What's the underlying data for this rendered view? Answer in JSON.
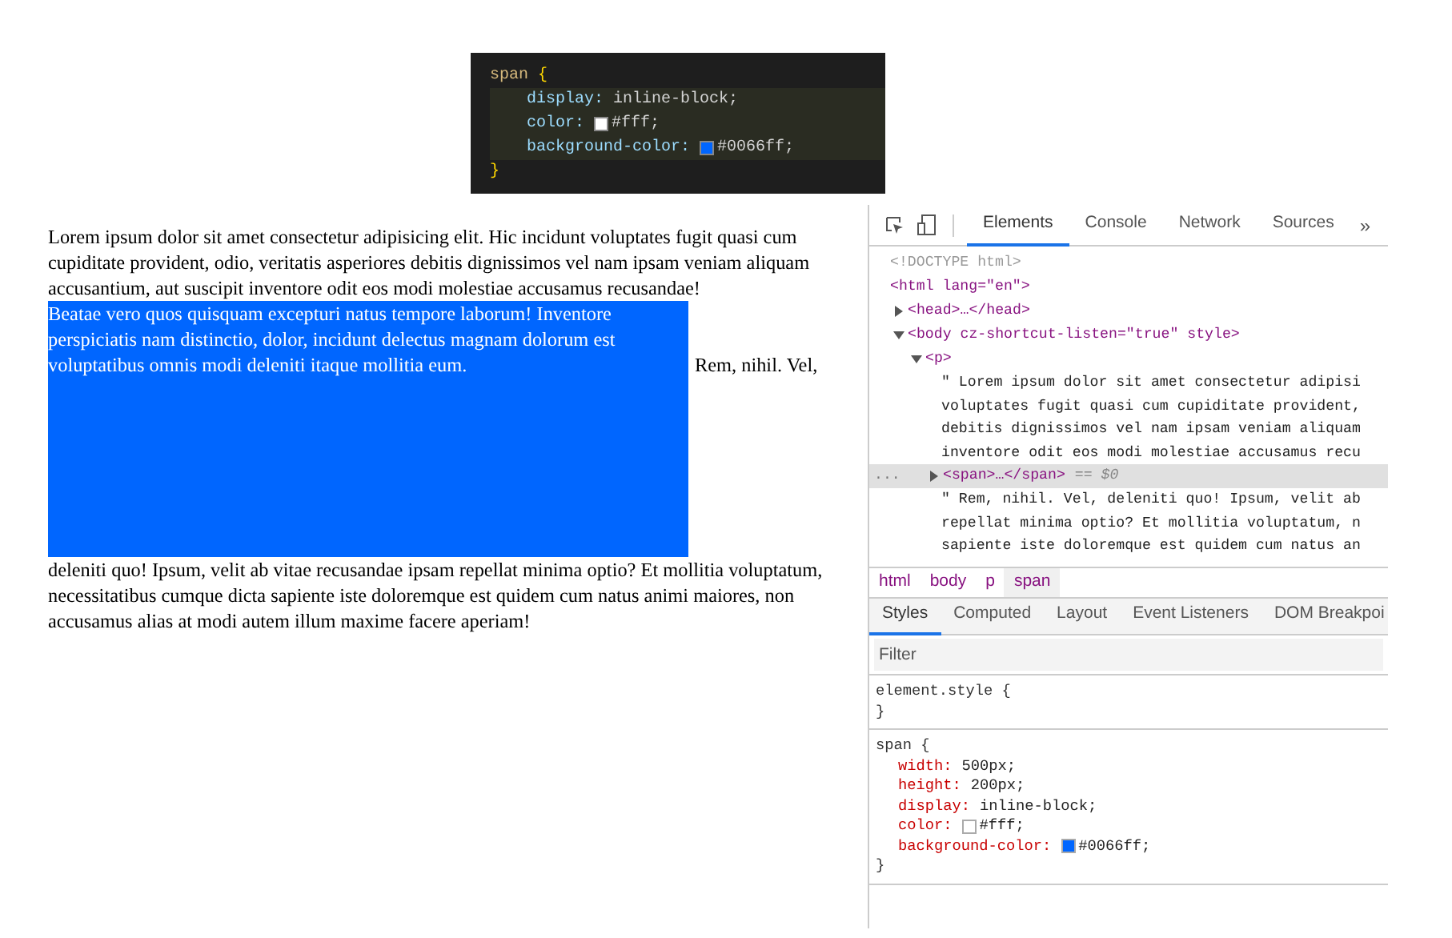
{
  "code_snippet": {
    "selector": "span",
    "open_brace": "{",
    "close_brace": "}",
    "declarations": [
      {
        "property": "display:",
        "value": "inline-block;"
      },
      {
        "property": "color:",
        "value": "#fff;",
        "color": "#ffffff"
      },
      {
        "property": "background-color:",
        "value": "#0066ff;",
        "color": "#0066ff"
      }
    ]
  },
  "page": {
    "text_before": "Lorem ipsum dolor sit amet consectetur adipisicing elit. Hic incidunt voluptates fugit quasi cum cupiditate provident, odio, veritatis asperiores debitis dignissimos vel nam ipsam veniam aliquam accusantium, aut suscipit inventore odit eos modi molestiae accusamus recusandae!",
    "span_text": "Beatae vero quos quisquam excepturi natus tempore laborum! Inventore perspiciatis nam distinctio, dolor, incidunt delectus magnam dolorum est voluptatibus omnis modi deleniti itaque mollitia eum.",
    "text_after_inline": "Rem, nihil. Vel,",
    "text_after": "deleniti quo! Ipsum, velit ab vitae recusandae ipsam repellat minima optio? Et mollitia voluptatum, necessitatibus cumque dicta sapiente iste doloremque est quidem cum natus animi maiores, non accusamus alias at modi autem illum maxime facere aperiam!"
  },
  "devtools": {
    "tabs": [
      {
        "label": "Elements",
        "selected": true
      },
      {
        "label": "Console",
        "selected": false
      },
      {
        "label": "Network",
        "selected": false
      },
      {
        "label": "Sources",
        "selected": false
      }
    ],
    "more_tabs": "»",
    "tree": [
      {
        "kind": "doctype",
        "text": "<!DOCTYPE html>"
      },
      {
        "kind": "element",
        "text": "<html lang=\"en\">",
        "children": [
          {
            "kind": "element",
            "text": "<head>…</head>",
            "expanded": false
          },
          {
            "kind": "element",
            "text": "<body cz-shortcut-listen=\"true\" style>",
            "expanded": true,
            "children": [
              {
                "kind": "element",
                "text": "<p>",
                "expanded": true,
                "children": [
                  {
                    "kind": "text",
                    "lines": [
                      "\" Lorem ipsum dolor sit amet consectetur adipisi",
                      "voluptates fugit quasi cum cupiditate provident,",
                      "debitis dignissimos vel nam ipsam veniam aliquam",
                      "inventore odit eos modi molestiae accusamus recu"
                    ]
                  },
                  {
                    "kind": "element",
                    "text": "<span>…</span>",
                    "expanded": false,
                    "selected": true,
                    "marker": "...",
                    "suffix": "== $0"
                  },
                  {
                    "kind": "text",
                    "lines": [
                      "\" Rem, nihil. Vel, deleniti quo! Ipsum, velit ab",
                      "repellat minima optio? Et mollitia voluptatum, n",
                      "sapiente iste doloremque est quidem cum natus an"
                    ]
                  }
                ]
              }
            ]
          }
        ]
      }
    ],
    "breadcrumbs": [
      {
        "label": "html",
        "selected": false
      },
      {
        "label": "body",
        "selected": false
      },
      {
        "label": "p",
        "selected": false
      },
      {
        "label": "span",
        "selected": true
      }
    ],
    "style_tabs": [
      {
        "label": "Styles",
        "selected": true
      },
      {
        "label": "Computed",
        "selected": false
      },
      {
        "label": "Layout",
        "selected": false
      },
      {
        "label": "Event Listeners",
        "selected": false
      },
      {
        "label": "DOM Breakpoi",
        "selected": false
      }
    ],
    "filter": {
      "placeholder": "Filter"
    },
    "rules": [
      {
        "selector": "element.style {",
        "close": "}"
      },
      {
        "selector": "span {",
        "close": "}",
        "declarations": [
          {
            "property": "width:",
            "value": "500px;"
          },
          {
            "property": "height:",
            "value": "200px;"
          },
          {
            "property": "display:",
            "value": "inline-block;"
          },
          {
            "property": "color:",
            "value": "#fff;",
            "color": "#ffffff"
          },
          {
            "property": "background-color:",
            "value": "#0066ff;",
            "color": "#0066ff"
          }
        ]
      }
    ]
  }
}
